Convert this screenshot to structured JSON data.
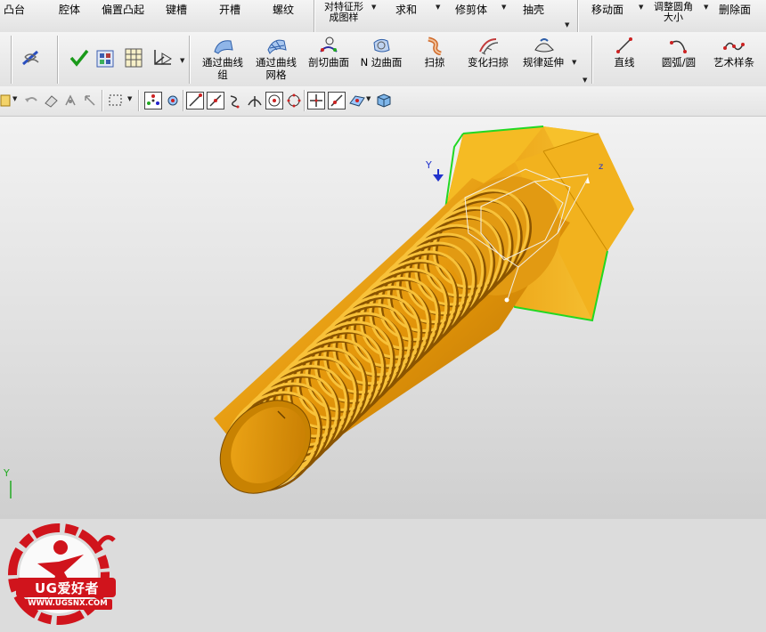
{
  "ribbon_top": {
    "items": [
      {
        "label": "凸台"
      },
      {
        "label": "腔体"
      },
      {
        "label": "偏置凸起"
      },
      {
        "label": "键槽"
      },
      {
        "label": "开槽"
      },
      {
        "label": "螺纹"
      },
      {
        "label": "对特征形成图样"
      },
      {
        "label": "求和"
      },
      {
        "label": "修剪体"
      },
      {
        "label": "抽壳"
      },
      {
        "label": "移动面"
      },
      {
        "label": "调整圆角大小"
      },
      {
        "label": "删除面"
      }
    ],
    "wrapped": {
      "pattern_line1": "对特征形",
      "pattern_line2": "成图样",
      "resize_line1": "调整圆角",
      "resize_line2": "大小"
    }
  },
  "ribbon_tools": {
    "through_curves_line1": "通过曲线",
    "through_curves_line2": "组",
    "through_mesh_line1": "通过曲线",
    "through_mesh_line2": "网格",
    "section_surface": "剖切曲面",
    "n_sided": "N 边曲面",
    "swept": "扫掠",
    "variational_sweep": "变化扫掠",
    "law_extension": "规律延伸",
    "line": "直线",
    "arc_circle": "圆弧/圆",
    "studio_spline": "艺术样条"
  },
  "icons": [
    "thread-icon",
    "check-icon",
    "matrix-icon",
    "grid-icon",
    "axis-icon",
    "curve-line-icon",
    "curve-point-icon",
    "arc-snap-icon",
    "center-icon",
    "quadrant-icon",
    "cross-icon",
    "cube-icon"
  ],
  "colors": {
    "bolt": "#e8a20a",
    "bolt_dark": "#9a6000",
    "edge_highlight": "#22d822",
    "logo_red": "#d0141c",
    "axis_blue": "#2233cc"
  },
  "viewport": {
    "axis_label": "Y",
    "logo_brand": "UG爱好者",
    "logo_url": "WWW.UGSNX.COM",
    "corner_axis": "Y"
  }
}
